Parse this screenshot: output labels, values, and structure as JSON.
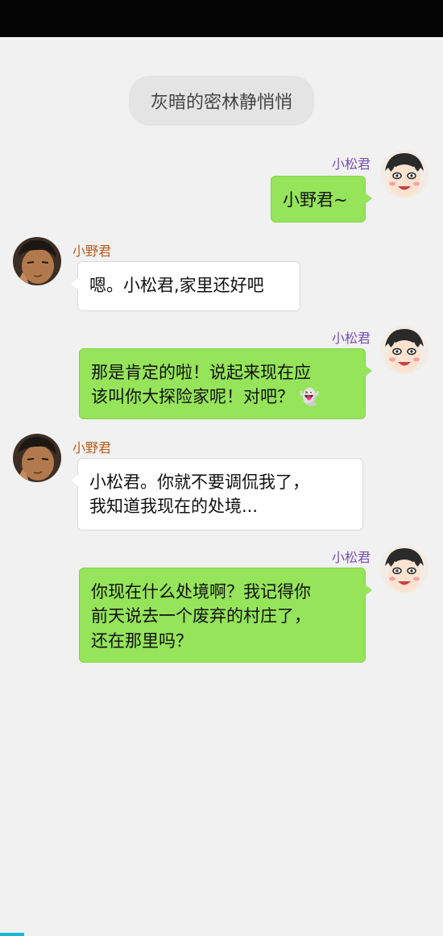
{
  "header": {
    "title": "灰暗的密林静悄悄"
  },
  "messages": [
    {
      "sender": "小松君",
      "side": "right",
      "text": "小野君~"
    },
    {
      "sender": "小野君",
      "side": "left",
      "text": "嗯。小松君,家里还好吧"
    },
    {
      "sender": "小松君",
      "side": "right",
      "lines": [
        "那是肯定的啦！说起来现在应",
        "该叫你大探险家呢！对吧？"
      ],
      "emoji": "ghost-icon"
    },
    {
      "sender": "小野君",
      "side": "left",
      "lines": [
        "小松君。你就不要调侃我了，",
        "我知道我现在的处境..."
      ]
    },
    {
      "sender": "小松君",
      "side": "right",
      "lines": [
        "你现在什么处境啊？我记得你",
        "前天说去一个废弃的村庄了，",
        "还在那里吗？"
      ]
    }
  ],
  "colors": {
    "green_bubble": "#95e45a",
    "white_bubble": "#ffffff",
    "background": "#f1f1f1",
    "right_name": "#7a4fb3",
    "left_name": "#b85c1e"
  }
}
